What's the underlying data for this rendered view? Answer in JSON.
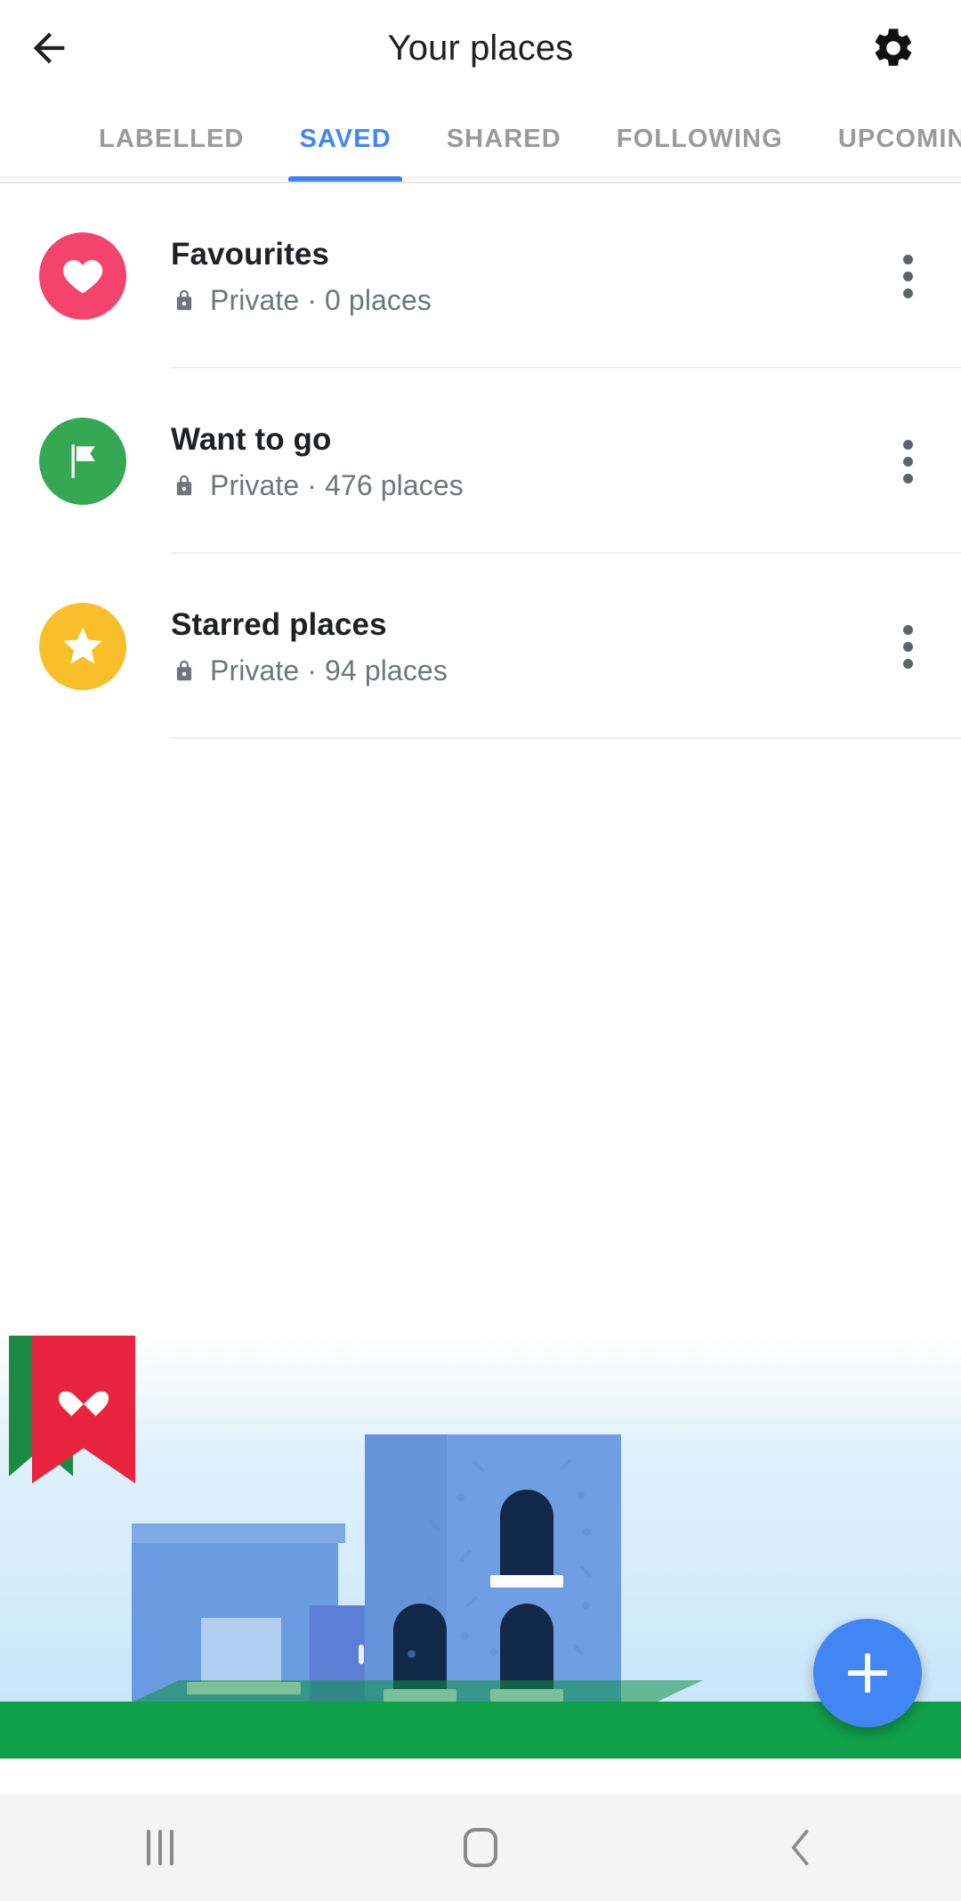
{
  "appbar": {
    "back_icon": "arrow-left-icon",
    "title": "Your places",
    "settings_icon": "gear-icon"
  },
  "tabs": {
    "items": [
      {
        "label": "LABELLED",
        "active": false
      },
      {
        "label": "SAVED",
        "active": true
      },
      {
        "label": "SHARED",
        "active": false
      },
      {
        "label": "FOLLOWING",
        "active": false
      },
      {
        "label": "UPCOMING",
        "active": false
      }
    ],
    "active_index": 1,
    "active_color": "#4285f4",
    "inactive_color": "#9a9a9a"
  },
  "lists": {
    "rows": [
      {
        "title": "Favourites",
        "icon": "heart-icon",
        "icon_color": "#f4436c",
        "privacy": "Private",
        "separator": "·",
        "count": "0 places",
        "subtitle": "Private · 0 places",
        "lock_icon": "lock-icon",
        "more_icon": "more-vertical-icon"
      },
      {
        "title": "Want to go",
        "icon": "flag-icon",
        "icon_color": "#34a853",
        "privacy": "Private",
        "separator": "·",
        "count": "476 places",
        "subtitle": "Private · 476 places",
        "lock_icon": "lock-icon",
        "more_icon": "more-vertical-icon"
      },
      {
        "title": "Starred places",
        "icon": "star-icon",
        "icon_color": "#f9bf2b",
        "privacy": "Private",
        "separator": "·",
        "count": "94 places",
        "subtitle": "Private · 94 places",
        "lock_icon": "lock-icon",
        "more_icon": "more-vertical-icon"
      }
    ]
  },
  "illustration": {
    "name": "saved-places-empty-illustration",
    "sky_color": "#cfe9fa",
    "grass_color": "#10a04a",
    "building_color": "#6f9ee2",
    "banner_color": "#e8243f",
    "flag_color": "#1a8a42",
    "banner_icon": "heart-icon",
    "window_color": "#122848"
  },
  "fab": {
    "icon": "plus-icon",
    "label": "+",
    "color": "#4285f4"
  },
  "navbar": {
    "recents_icon": "recents-icon",
    "home_icon": "home-icon",
    "back_icon": "back-chevron-icon"
  }
}
